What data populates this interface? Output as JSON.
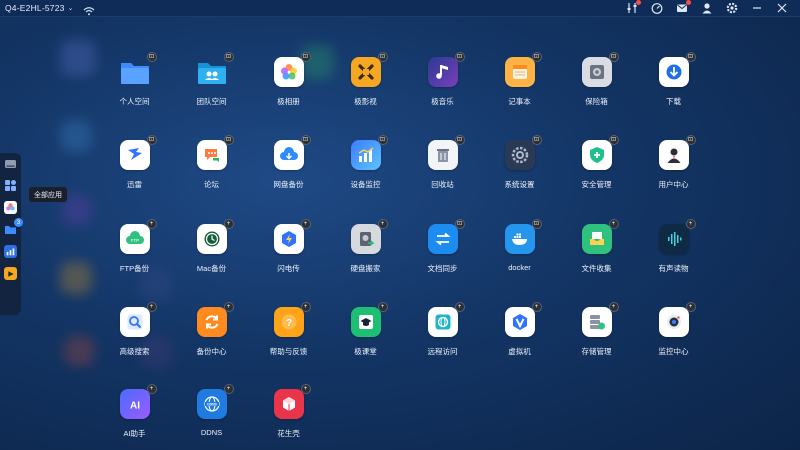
{
  "topbar": {
    "device_name": "Q4-E2HL-5723",
    "icons": [
      "wifi-icon",
      "tune-icon",
      "gauge-icon",
      "mail-icon",
      "user-icon",
      "gear-icon",
      "minimize-icon",
      "close-icon"
    ]
  },
  "dock": {
    "items": [
      "storage-icon",
      "all-apps-icon",
      "photos-icon",
      "folder-icon",
      "chart-icon",
      "media-icon"
    ],
    "folder_badge": "3",
    "tooltip": "全部应用"
  },
  "apps": [
    {
      "label": "个人空间",
      "icon": "personal-folder-icon",
      "color": "#3d8bff",
      "badge": "lock"
    },
    {
      "label": "团队空间",
      "icon": "team-folder-icon",
      "color": "#1aa0e8",
      "badge": "lock"
    },
    {
      "label": "极相册",
      "icon": "photos-icon",
      "color": "#ffffff",
      "badge": "lock"
    },
    {
      "label": "极影视",
      "icon": "video-icon",
      "color": "#f5a623",
      "badge": "lock"
    },
    {
      "label": "极音乐",
      "icon": "music-icon",
      "color": "#1b2338",
      "badge": "lock"
    },
    {
      "label": "记事本",
      "icon": "notepad-icon",
      "color": "#ffb347",
      "badge": "lock"
    },
    {
      "label": "保险箱",
      "icon": "safe-icon",
      "color": "#d9dde3",
      "badge": "lock"
    },
    {
      "label": "下载",
      "icon": "download-icon",
      "color": "#ffffff",
      "badge": "lock"
    },
    {
      "label": "迅雷",
      "icon": "thunder-icon",
      "color": "#ffffff",
      "badge": "lock"
    },
    {
      "label": "论坛",
      "icon": "forum-icon",
      "color": "#ffffff",
      "badge": "lock"
    },
    {
      "label": "网盘备份",
      "icon": "cloud-backup-icon",
      "color": "#ffffff",
      "badge": "lock"
    },
    {
      "label": "设备监控",
      "icon": "monitor-chart-icon",
      "color": "#3b7dff",
      "badge": "lock"
    },
    {
      "label": "回收站",
      "icon": "trash-icon",
      "color": "#f2f4f7",
      "badge": "lock"
    },
    {
      "label": "系统设置",
      "icon": "settings-icon",
      "color": "#2a3a55",
      "badge": "lock"
    },
    {
      "label": "安全管理",
      "icon": "shield-icon",
      "color": "#ffffff",
      "badge": "lock"
    },
    {
      "label": "用户中心",
      "icon": "user-center-icon",
      "color": "#ffffff",
      "badge": "lock"
    },
    {
      "label": "FTP备份",
      "icon": "ftp-icon",
      "color": "#ffffff",
      "badge": "plus"
    },
    {
      "label": "Mac备份",
      "icon": "time-machine-icon",
      "color": "#ffffff",
      "badge": "plus"
    },
    {
      "label": "闪电传",
      "icon": "flash-transfer-icon",
      "color": "#ffffff",
      "badge": "plus"
    },
    {
      "label": "硬盘搬家",
      "icon": "disk-move-icon",
      "color": "#d6d9de",
      "badge": "plus"
    },
    {
      "label": "文档同步",
      "icon": "sync-icon",
      "color": "#1d8cf0",
      "badge": "lock"
    },
    {
      "label": "docker",
      "icon": "docker-icon",
      "color": "#2496ed",
      "badge": "lock"
    },
    {
      "label": "文件收集",
      "icon": "file-collect-icon",
      "color": "#2ec27e",
      "badge": "plus"
    },
    {
      "label": "有声读物",
      "icon": "audiobook-icon",
      "color": "#0f2a45",
      "badge": "plus"
    },
    {
      "label": "高级搜索",
      "icon": "search-icon",
      "color": "#ffffff",
      "badge": "plus"
    },
    {
      "label": "备份中心",
      "icon": "backup-center-icon",
      "color": "#ff8a1f",
      "badge": "plus"
    },
    {
      "label": "帮助与反馈",
      "icon": "help-icon",
      "color": "#ffa318",
      "badge": "plus"
    },
    {
      "label": "极课堂",
      "icon": "classroom-icon",
      "color": "#1dbf73",
      "badge": "plus"
    },
    {
      "label": "远程访问",
      "icon": "remote-access-icon",
      "color": "#ffffff",
      "badge": "plus"
    },
    {
      "label": "虚拟机",
      "icon": "vm-icon",
      "color": "#ffffff",
      "badge": "plus"
    },
    {
      "label": "存储管理",
      "icon": "storage-manage-icon",
      "color": "#ffffff",
      "badge": "plus"
    },
    {
      "label": "监控中心",
      "icon": "camera-icon",
      "color": "#ffffff",
      "badge": "plus"
    },
    {
      "label": "AI助手",
      "icon": "ai-icon",
      "color": "#4a6bff",
      "badge": "plus"
    },
    {
      "label": "DDNS",
      "icon": "ddns-icon",
      "color": "#1f7be0",
      "badge": "plus"
    },
    {
      "label": "花生壳",
      "icon": "peanut-icon",
      "color": "#e8354a",
      "badge": "plus"
    }
  ]
}
